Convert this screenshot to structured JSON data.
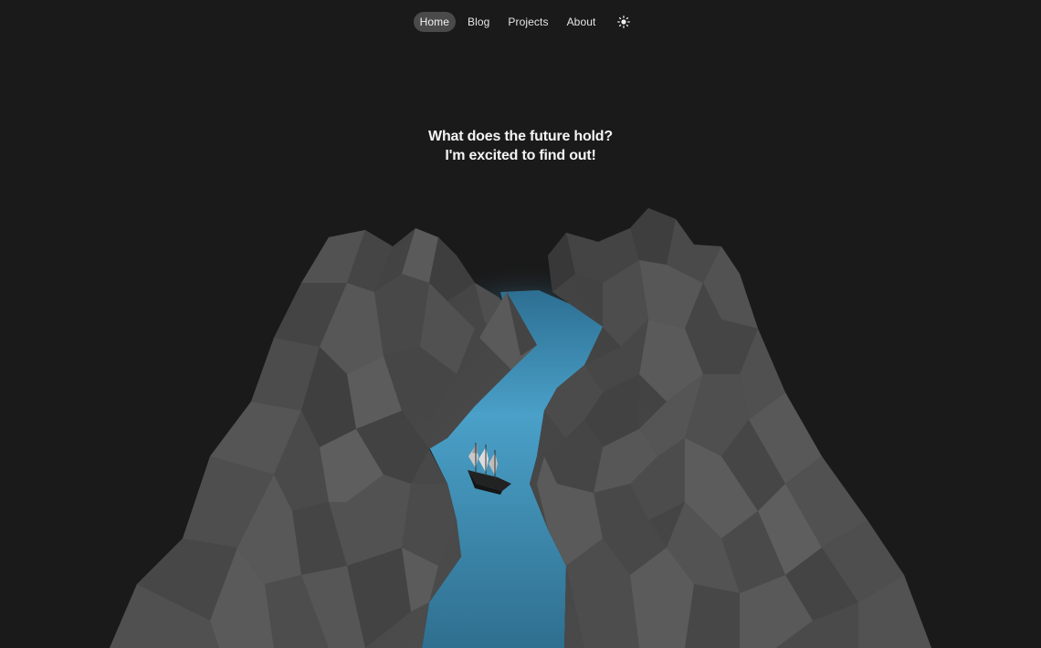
{
  "nav": {
    "items": [
      {
        "label": "Home",
        "active": true
      },
      {
        "label": "Blog",
        "active": false
      },
      {
        "label": "Projects",
        "active": false
      },
      {
        "label": "About",
        "active": false
      }
    ],
    "theme_toggle_icon": "sun-icon"
  },
  "hero": {
    "line1": "What does the future hold?",
    "line2": "I'm excited to find out!"
  },
  "colors": {
    "background": "#1a1a1a",
    "nav_active_bg": "#4a4a4a",
    "water": "#3a8fb8",
    "rock": "#4a4a4a"
  }
}
